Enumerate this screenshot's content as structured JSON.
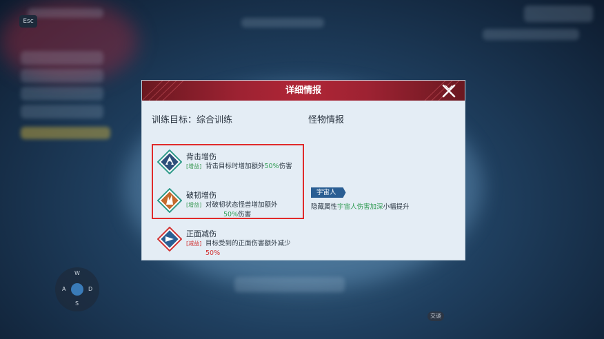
{
  "hud": {
    "esc_label": "Esc",
    "joystick": {
      "up": "W",
      "left": "A",
      "right": "D",
      "down": "S"
    },
    "bottom_chip": "交谈"
  },
  "panel": {
    "title": "详细情报",
    "training_goal": "训练目标：综合训练",
    "monster_info_title": "怪物情报",
    "skills": [
      {
        "name": "背击增伤",
        "tag": "[增益]",
        "desc_prefix": "背击目标时增加额外",
        "percent": "50%",
        "desc_suffix": "伤害",
        "icon": "back-attack-icon",
        "icon_color": "#2f9a8a"
      },
      {
        "name": "破韧增伤",
        "tag": "[增益]",
        "desc_prefix": "对破韧状态怪兽增加额外",
        "percent": "50%",
        "desc_suffix": "伤害",
        "icon": "break-toughness-icon",
        "icon_color": "#c56a2e"
      },
      {
        "name": "正面减伤",
        "tag": "[减益]",
        "desc_prefix": "目标受到的正面伤害额外减少",
        "percent": "50%",
        "desc_suffix": "",
        "icon": "frontal-reduction-icon",
        "icon_color": "#2a5e93"
      }
    ],
    "monster": {
      "badge": "宇宙人",
      "desc_prefix": "隐藏属性",
      "desc_highlight": "宇宙人伤害加深",
      "desc_suffix": "小幅提升"
    }
  },
  "colors": {
    "header_red": "#b02636",
    "highlight_border": "#e02a2a",
    "buff_green": "#2f9a52",
    "debuff_red": "#d13232",
    "badge_blue": "#2a5e93"
  }
}
